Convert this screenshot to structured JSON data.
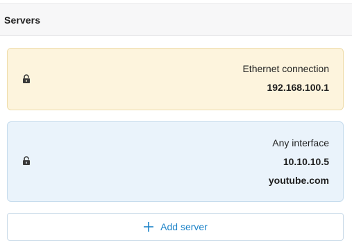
{
  "header": {
    "title": "Servers"
  },
  "servers": [
    {
      "interface": "Ethernet connection",
      "address": "192.168.100.1",
      "icon": "lock-icon",
      "color": "#fdf4dd"
    },
    {
      "interface": "Any interface",
      "address": "10.10.10.5",
      "domain": "youtube.com",
      "icon": "lock-icon",
      "color": "#eaf3fb"
    }
  ],
  "add_button": {
    "label": "Add server",
    "icon": "plus-icon",
    "accent": "#1d83c8"
  }
}
